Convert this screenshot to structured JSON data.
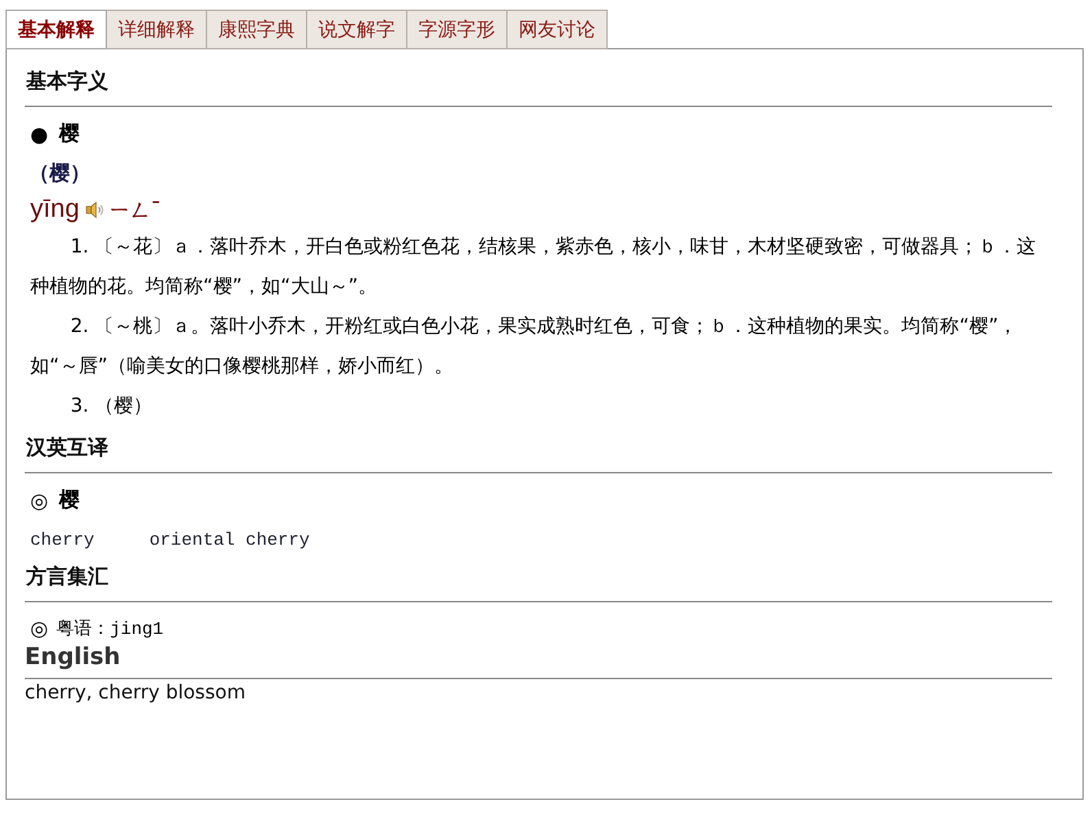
{
  "tabs": [
    {
      "label": "基本解释",
      "selected": true
    },
    {
      "label": "详细解释",
      "selected": false
    },
    {
      "label": "康熙字典",
      "selected": false
    },
    {
      "label": "说文解字",
      "selected": false
    },
    {
      "label": "字源字形",
      "selected": false
    },
    {
      "label": "网友讨论",
      "selected": false
    }
  ],
  "sections": [
    {
      "kind": "cn",
      "title": "基本字义",
      "items": [
        {
          "kind": "headword",
          "marker": "●",
          "text": "樱"
        },
        {
          "kind": "variant",
          "text": "（樱）"
        },
        {
          "kind": "pinyin",
          "text": "yīng",
          "zhuyin": "ㄧㄥˉ"
        },
        {
          "kind": "definition",
          "number": "1.",
          "text": "〔～花〕ａ．落叶乔木，开白色或粉红色花，结核果，紫赤色，核小，味甘，木材坚硬致密，可做器具；ｂ．这种植物的花。均简称“樱”，如“大山～”。"
        },
        {
          "kind": "definition",
          "number": "2.",
          "text": "〔～桃〕ａ。落叶小乔木，开粉红或白色小花，果实成熟时红色，可食；ｂ．这种植物的果实。均简称“樱”，如“～唇”（喻美女的口像樱桃那样，娇小而红）。"
        },
        {
          "kind": "definition",
          "number": "3.",
          "text": "（樱）"
        }
      ]
    },
    {
      "kind": "cn",
      "title": "汉英互译",
      "items": [
        {
          "kind": "headword",
          "marker": "◎",
          "text": "樱"
        },
        {
          "kind": "words",
          "words": [
            "cherry",
            "oriental cherry"
          ]
        }
      ]
    },
    {
      "kind": "cn",
      "title": "方言集汇",
      "items": [
        {
          "kind": "dialect",
          "marker": "◎",
          "label": "粤语：",
          "text": "jing1"
        }
      ]
    },
    {
      "kind": "en",
      "title": "English",
      "items": [
        {
          "kind": "plain",
          "text": "cherry, cherry blossom"
        }
      ]
    }
  ]
}
